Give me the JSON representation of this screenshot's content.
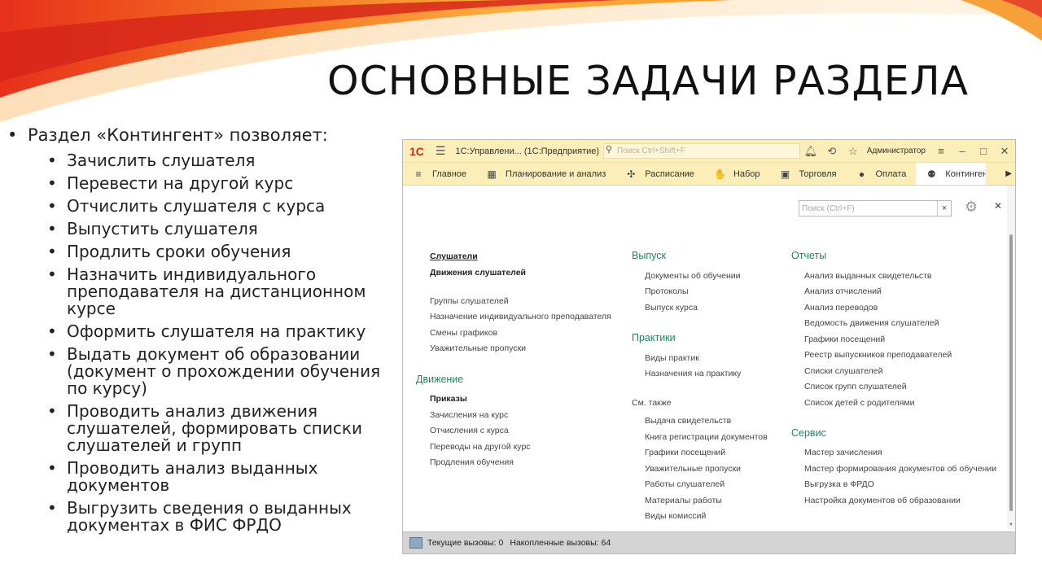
{
  "slide": {
    "title": "ОСНОВНЫЕ ЗАДАЧИ РАЗДЕЛА",
    "intro": "Раздел «Контингент» позволяет:",
    "items": [
      "Зачислить слушателя",
      "Перевести на другой курс",
      "Отчислить слушателя с курса",
      "Выпустить слушателя",
      "Продлить сроки обучения",
      "Назначить индивидуального преподавателя на дистанционном курсе",
      "Оформить слушателя на практику",
      "Выдать документ об образовании (документ о прохождении обучения по курсу)",
      "Проводить анализ движения слушателей, формировать списки слушателей и групп",
      "Проводить анализ выданных документов",
      "Выгрузить сведения о выданных документах в ФИС ФРДО"
    ]
  },
  "window": {
    "logo": "1С",
    "app_title": "1С:Управлени... (1С:Предприятие)",
    "search_placeholder": "Поиск Ctrl+Shift+F",
    "user": "Администратор",
    "menu": [
      {
        "label": "Главное",
        "icon": "≡"
      },
      {
        "label": "Планирование и анализ",
        "icon": "▦"
      },
      {
        "label": "Расписание",
        "icon": "✣"
      },
      {
        "label": "Набор",
        "icon": "✋"
      },
      {
        "label": "Торговля",
        "icon": "▣"
      },
      {
        "label": "Оплата",
        "icon": "●"
      },
      {
        "label": "Контингент",
        "icon": "⚉"
      }
    ],
    "form_search_placeholder": "Поиск (Ctrl+F)",
    "form_search_clear": "×",
    "col1": {
      "top": [
        "Слушатели",
        "Движения слушателей"
      ],
      "links": [
        "Группы слушателей",
        "Назначение индивидуального преподавателя",
        "Смены графиков",
        "Уважительные пропуски"
      ],
      "movement_title": "Движение",
      "movement_bold": "Приказы",
      "movement_links": [
        "Зачисления на курс",
        "Отчисления с курса",
        "Переводы на другой курс",
        "Продления обучения"
      ]
    },
    "col2": {
      "release_title": "Выпуск",
      "release_links": [
        "Документы об обучении",
        "Протоколы",
        "Выпуск курса"
      ],
      "practice_title": "Практики",
      "practice_links": [
        "Виды практик",
        "Назначения на практику"
      ],
      "see_also": "См. также",
      "see_links": [
        "Выдача свидетельств",
        "Книга регистрации документов",
        "Графики посещений",
        "Уважительные пропуски",
        "Работы слушателей",
        "Материалы работы",
        "Виды комиссий"
      ]
    },
    "col3": {
      "reports_title": "Отчеты",
      "reports_links": [
        "Анализ выданных свидетельств",
        "Анализ отчислений",
        "Анализ переводов",
        "Ведомость движения слушателей",
        "Графики посещений",
        "Реестр выпускников преподавателей",
        "Списки слушателей",
        "Список групп слушателей",
        "Список детей с родителями"
      ],
      "service_title": "Сервис",
      "service_links": [
        "Мастер зачисления",
        "Мастер формирования документов об обучении",
        "Выгрузка в ФРДО",
        "Настройка документов об образовании"
      ]
    },
    "status": {
      "current": "Текущие вызовы: 0",
      "accum": "Накопленные вызовы: 64"
    }
  },
  "colors": {
    "accent_green": "#1a8a59",
    "titlebar": "#fbeeb8",
    "logo_red": "#d52b1e"
  }
}
